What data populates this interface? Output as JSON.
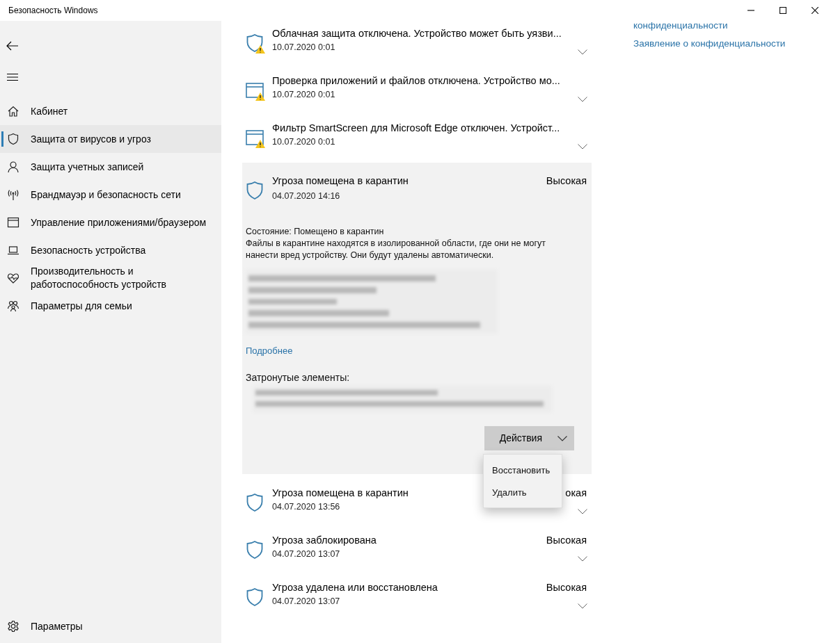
{
  "window": {
    "title": "Безопасность Windows"
  },
  "sidebar": {
    "items": [
      {
        "kind": "home",
        "label": "Кабинет",
        "selected": false
      },
      {
        "kind": "shield",
        "label": "Защита от вирусов и угроз",
        "selected": true
      },
      {
        "kind": "person",
        "label": "Защита учетных записей",
        "selected": false
      },
      {
        "kind": "antenna",
        "label": "Брандмауэр и безопасность сети",
        "selected": false
      },
      {
        "kind": "window",
        "label": "Управление приложениями/браузером",
        "selected": false
      },
      {
        "kind": "laptop",
        "label": "Безопасность устройства",
        "selected": false
      },
      {
        "kind": "heart",
        "label": "Производительность и\nработоспособность устройств",
        "selected": false
      },
      {
        "kind": "family",
        "label": "Параметры для семьи",
        "selected": false
      }
    ],
    "settings": {
      "label": "Параметры"
    }
  },
  "history": [
    {
      "kind": "shield",
      "warning": true,
      "title": "Облачная защита отключена. Устройство может быть уязви...",
      "date": "10.07.2020 0:01",
      "expanded": false
    },
    {
      "kind": "window",
      "warning": true,
      "title": "Проверка приложений и файлов отключена. Устройство мо...",
      "date": "10.07.2020 0:01",
      "expanded": false
    },
    {
      "kind": "window",
      "warning": true,
      "title": "Фильтр SmartScreen для Microsoft Edge отключен. Устройст...",
      "date": "10.07.2020 0:01",
      "expanded": false
    },
    {
      "kind": "shield",
      "warning": false,
      "title": "Угроза помещена в карантин",
      "severity": "Высокая",
      "date": "04.07.2020 14:16",
      "expanded": true,
      "details": {
        "status": "Состояние: Помещено в карантин",
        "description": "Файлы в карантине находятся в изолированной области, где они не могут нанести вред устройству. Они будут удалены автоматически.",
        "link": "Подробнее",
        "affected_label": "Затронутые элементы:",
        "actions_button": "Действия",
        "menu_open": true,
        "menu_items": [
          "Восстановить",
          "Удалить"
        ]
      }
    },
    {
      "kind": "shield",
      "warning": false,
      "title": "Угроза помещена в карантин",
      "severity": "окая",
      "date": "04.07.2020 13:56",
      "expanded": false
    },
    {
      "kind": "shield",
      "warning": false,
      "title": "Угроза заблокирована",
      "severity": "Высокая",
      "date": "04.07.2020 13:07",
      "expanded": false
    },
    {
      "kind": "shield",
      "warning": false,
      "title": "Угроза удалена или восстановлена",
      "severity": "Высокая",
      "date": "04.07.2020 13:07",
      "expanded": false
    }
  ],
  "privacy_links": [
    "конфиденциальности",
    "Заявление о конфиденциальности"
  ]
}
